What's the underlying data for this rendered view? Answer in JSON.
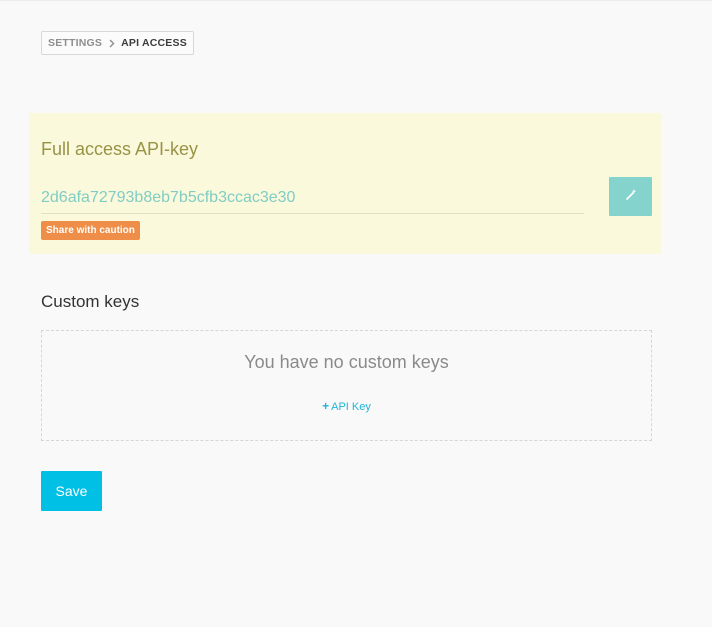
{
  "breadcrumb": {
    "parent": "SETTINGS",
    "separator_icon": "chevron-right-icon",
    "current": "API ACCESS"
  },
  "full_access": {
    "title": "Full access API-key",
    "key_value": "2d6afa72793b8eb7b5cfb3ccac3e30",
    "caution_label": "Share with caution",
    "regenerate_icon": "magic-wand-icon"
  },
  "custom_keys": {
    "title": "Custom keys",
    "empty_message": "You have no custom keys",
    "add_icon": "plus-icon",
    "add_label": "API Key"
  },
  "actions": {
    "save_label": "Save"
  },
  "colors": {
    "panel_background": "#fbf9db",
    "panel_title": "#989347",
    "key_text": "#7fcdc4",
    "caution_badge": "#ef8e49",
    "regenerate_button": "#84d3cd",
    "link": "#1fb6d8",
    "save_button": "#00c0e6"
  }
}
